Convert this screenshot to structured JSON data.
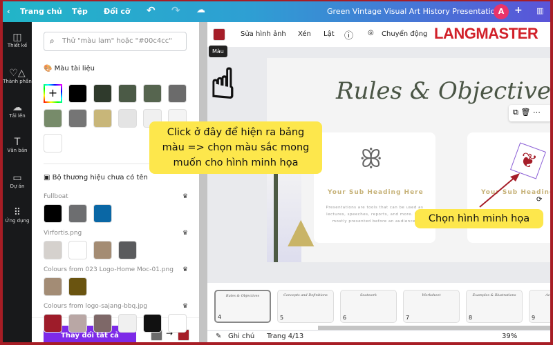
{
  "topbar": {
    "home": "Trang chủ",
    "file": "Tệp",
    "resize": "Đổi cỡ",
    "title": "Green Vintage Visual Art History Presentation",
    "avatar": "A",
    "plus": "+"
  },
  "rail": [
    {
      "label": "Thiết kế",
      "icon": "layout-icon"
    },
    {
      "label": "Thành phần",
      "icon": "elements-icon"
    },
    {
      "label": "Tải lên",
      "icon": "upload-icon"
    },
    {
      "label": "Văn bản",
      "icon": "text-icon"
    },
    {
      "label": "Dự án",
      "icon": "folder-icon"
    },
    {
      "label": "Ứng dụng",
      "icon": "apps-icon"
    }
  ],
  "panel": {
    "search_placeholder": "Thử \"màu lam\" hoặc \"#00c4cc\"",
    "doc_colors_title": "Màu tài liệu",
    "doc_colors": [
      "#000000",
      "#2f3a2c",
      "#4b5a46",
      "#56654f",
      "#6b6b6b",
      "#778b6a",
      "#757575",
      "#c8b679",
      "#e4e4e4",
      "#f0f0f0",
      "#f4f4f4",
      "#ffffff"
    ],
    "brand_title": "Bộ thương hiệu chưa có tên",
    "groups": [
      {
        "name": "Fullboat",
        "colors": [
          "#000000",
          "#6d6e70",
          "#0a67a5"
        ]
      },
      {
        "name": "Virfortis.png",
        "colors": [
          "#d5d1cd",
          "#ffffff",
          "#a48c73",
          "#5a5b5d"
        ]
      },
      {
        "name": "Colours from 023 Logo-Home Moc-01.png",
        "colors": [
          "#a38c75",
          "#6a5410"
        ]
      },
      {
        "name": "Colours from logo-sajang-bbq.jpg",
        "colors": [
          "#9e1c2a",
          "#b9a7a5",
          "#7e6868",
          "#f0f0f0",
          "#111111",
          "#ffffff"
        ]
      }
    ],
    "replace_all": "Thay đổi tất cả",
    "from_color": "#6b6b6b",
    "to_color": "#a51d28"
  },
  "toolbar": {
    "color": "#a51d28",
    "tooltip": "Màu",
    "edit_image": "Sửa hình ảnh",
    "crop": "Xén",
    "flip": "Lật",
    "animate": "Chuyển động"
  },
  "logo": "LANGMASTER",
  "slide": {
    "title": "Rules & Objectives",
    "sub_heading": "Your Sub Heading Here",
    "body": "Presentations are tools that can be used as lectures, speeches, reports, and more. It is mostly presented before an audience.",
    "sub_heading_2": "Your Sub Heading"
  },
  "callouts": {
    "main": "Click ở đây để hiện ra bảng màu => chọn màu sắc mong muốn cho hình minh họa",
    "select": "Chọn hình minh họa"
  },
  "pages": [
    {
      "n": "4",
      "t": "Rules & Objectives"
    },
    {
      "n": "5",
      "t": "Concepts and Definitions"
    },
    {
      "n": "6",
      "t": "Seatwork"
    },
    {
      "n": "7",
      "t": "Worksheet"
    },
    {
      "n": "8",
      "t": "Examples & Illustrations"
    },
    {
      "n": "9",
      "t": "Activity Time"
    }
  ],
  "bottom": {
    "notes": "Ghi chú",
    "page": "Trang 4/13",
    "zoom": "39%"
  }
}
